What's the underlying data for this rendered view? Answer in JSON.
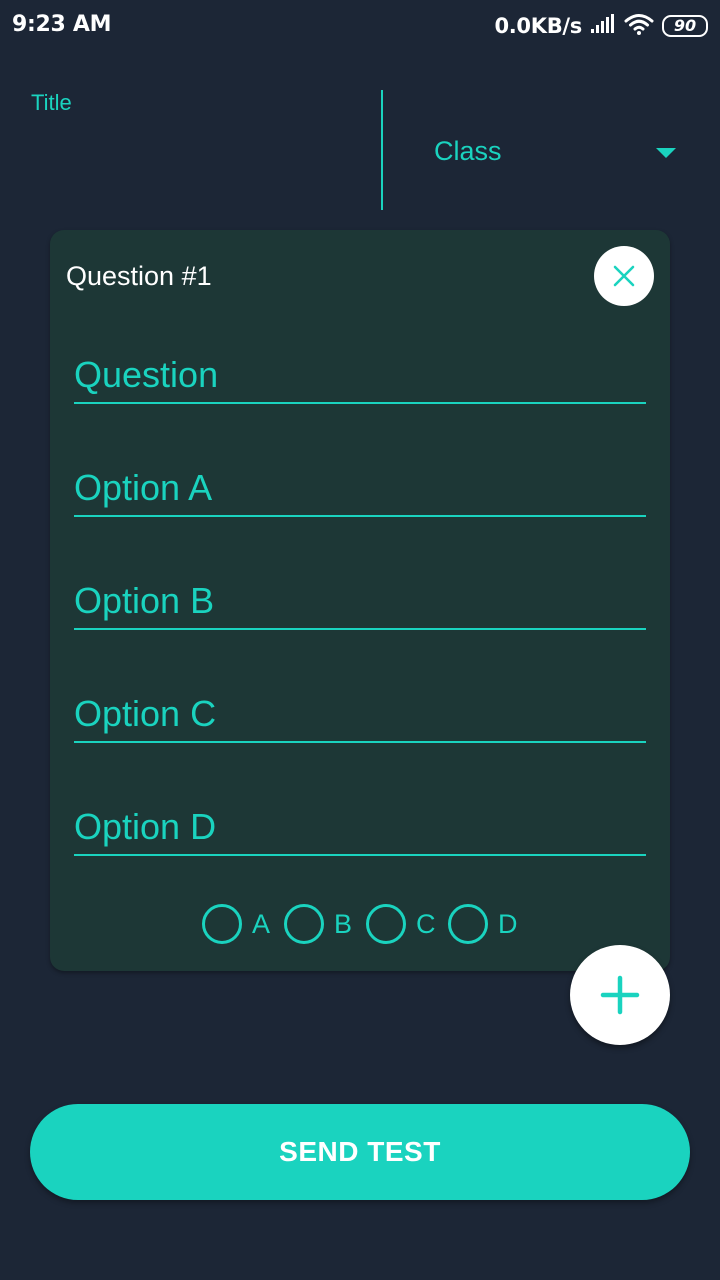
{
  "status_bar": {
    "time": "9:23 AM",
    "network_speed": "0.0KB/s",
    "battery_level": "90"
  },
  "header": {
    "title_label": "Title",
    "class_label": "Class"
  },
  "question_card": {
    "title": "Question #1",
    "fields": [
      {
        "placeholder": "Question",
        "value": ""
      },
      {
        "placeholder": "Option A",
        "value": ""
      },
      {
        "placeholder": "Option B",
        "value": ""
      },
      {
        "placeholder": "Option C",
        "value": ""
      },
      {
        "placeholder": "Option D",
        "value": ""
      }
    ],
    "answer_options": [
      "A",
      "B",
      "C",
      "D"
    ],
    "selected_answer": null
  },
  "send_button_label": "SEND TEST",
  "icons": {
    "close": "close-icon",
    "add": "plus-icon",
    "dropdown": "dropdown-arrow-icon",
    "signal": "signal-icon",
    "wifi": "wifi-icon",
    "battery": "battery-icon"
  },
  "colors": {
    "background": "#1c2636",
    "card": "#1d3736",
    "accent": "#1ad3bf",
    "white": "#ffffff"
  }
}
